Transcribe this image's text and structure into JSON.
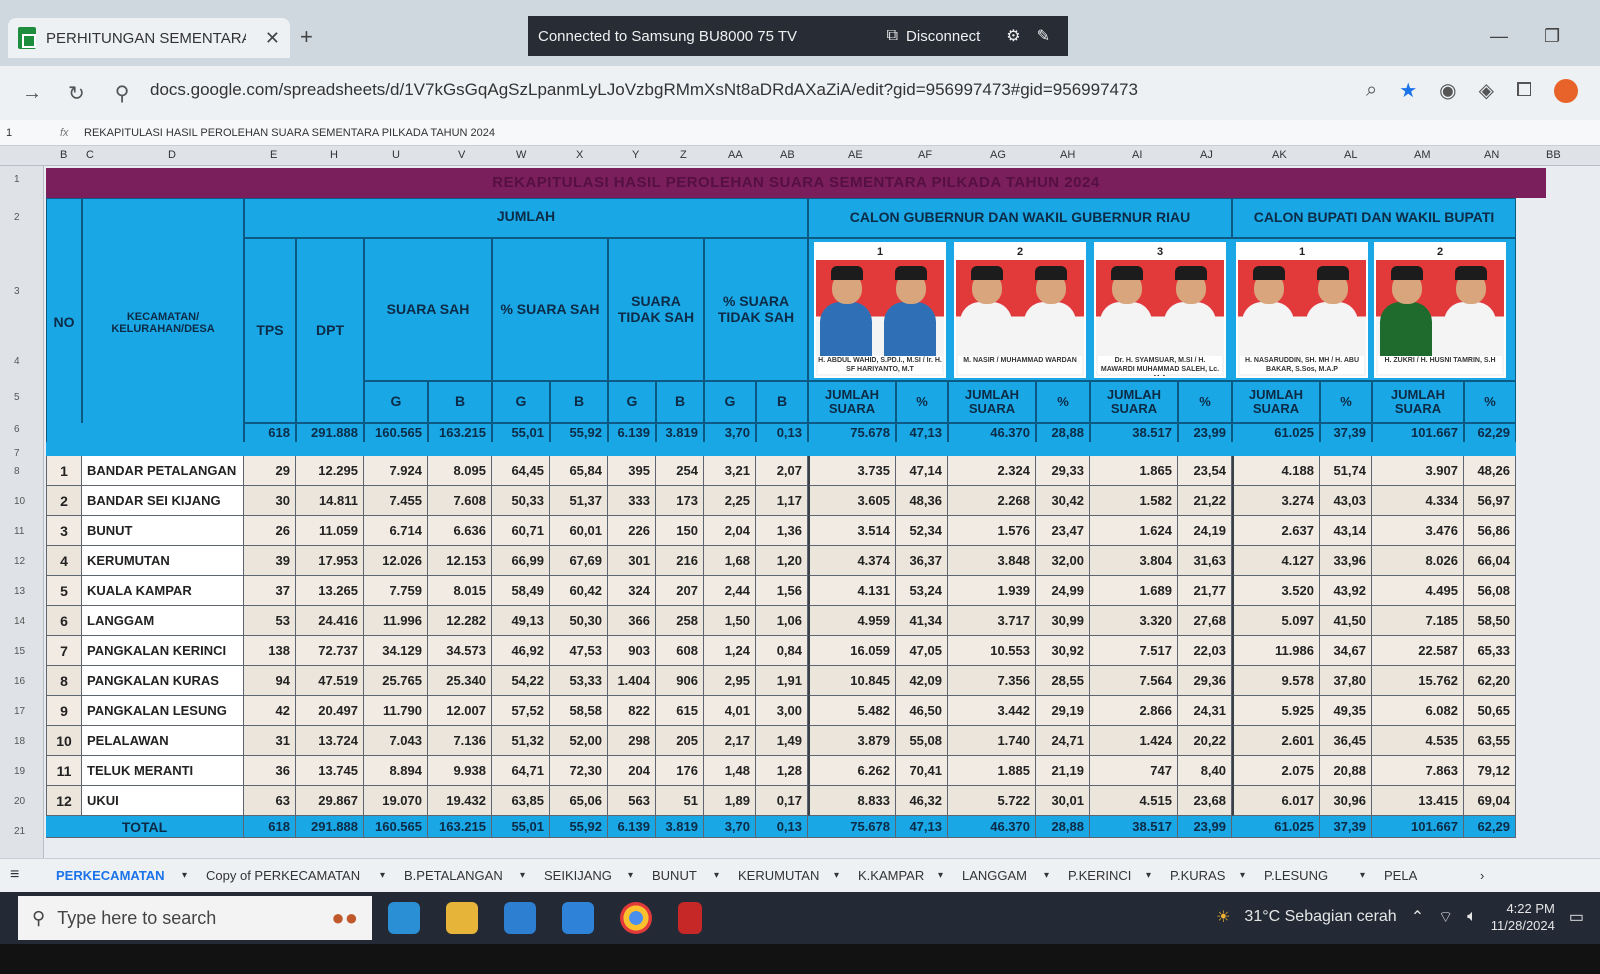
{
  "browser": {
    "tab_title": "PERHITUNGAN SEMENTARA PI",
    "close_glyph": "✕",
    "new_tab_glyph": "+",
    "cast_status": "Connected to Samsung BU8000 75 TV",
    "disconnect_label": "Disconnect",
    "url": "docs.google.com/spreadsheets/d/1V7kGsGqAgSzLpanmLyLJoVzbgRMmXsNt8aDRdAXaZiA/edit?gid=956997473#gid=956997473"
  },
  "formula_bar": {
    "cell_ref": "1",
    "fx": "fx",
    "content": "REKAPITULASI HASIL PEROLEHAN SUARA SEMENTARA PILKADA TAHUN 2024"
  },
  "column_letters": [
    "B",
    "C",
    "D",
    "E",
    "H",
    "U",
    "V",
    "W",
    "X",
    "Y",
    "Z",
    "AA",
    "AB",
    "AE",
    "AF",
    "AG",
    "AH",
    "AI",
    "AJ",
    "AK",
    "AL",
    "AM",
    "AN",
    "BB"
  ],
  "row_numbers": [
    "1",
    "2",
    "3",
    "4",
    "5",
    "6",
    "7",
    "8",
    "10",
    "11",
    "12",
    "13",
    "14",
    "15",
    "16",
    "17",
    "18",
    "19",
    "20",
    "21"
  ],
  "table": {
    "title": "REKAPITULASI HASIL PEROLEHAN SUARA SEMENTARA PILKADA TAHUN 2024",
    "headers": {
      "no": "NO",
      "kecamatan": "KECAMATAN/ KELURAHAN/DESA",
      "jumlah": "JUMLAH",
      "tps": "TPS",
      "dpt": "DPT",
      "suara_sah": "SUARA SAH",
      "pct_suara_sah": "% SUARA SAH",
      "suara_tidak_sah": "SUARA TIDAK SAH",
      "pct_suara_tidak_sah": "% SUARA TIDAK SAH",
      "gubernur": "CALON GUBERNUR DAN WAKIL GUBERNUR RIAU",
      "bupati": "CALON BUPATI DAN WAKIL BUPATI",
      "g": "G",
      "b": "B",
      "jumlah_suara": "JUMLAH SUARA",
      "pct": "%"
    },
    "candidates": [
      {
        "num": "1",
        "plate": "H. ABDUL WAHID, S.PD.I., M.SI / Ir. H. SF HARIYANTO, M.T"
      },
      {
        "num": "2",
        "plate": "M. NASIR / MUHAMMAD WARDAN"
      },
      {
        "num": "3",
        "plate": "Dr. H. SYAMSUAR, M.SI / H. MAWARDI MUHAMMAD SALEH, Lc. M.A"
      },
      {
        "num": "1",
        "plate": "H. NASARUDDIN, SH. MH / H. ABU BAKAR, S.Sos, M.A.P"
      },
      {
        "num": "2",
        "plate": "H. ZUKRI / H. HUSNI TAMRIN, S.H"
      }
    ],
    "summary": [
      "618",
      "291.888",
      "160.565",
      "163.215",
      "55,01",
      "55,92",
      "6.139",
      "3.819",
      "3,70",
      "0,13",
      "75.678",
      "47,13",
      "46.370",
      "28,88",
      "38.517",
      "23,99",
      "61.025",
      "37,39",
      "101.667",
      "62,29"
    ],
    "rows": [
      {
        "no": "1",
        "name": "BANDAR PETALANGAN",
        "v": [
          "29",
          "12.295",
          "7.924",
          "8.095",
          "64,45",
          "65,84",
          "395",
          "254",
          "3,21",
          "2,07",
          "3.735",
          "47,14",
          "2.324",
          "29,33",
          "1.865",
          "23,54",
          "4.188",
          "51,74",
          "3.907",
          "48,26"
        ]
      },
      {
        "no": "2",
        "name": "BANDAR SEI KIJANG",
        "v": [
          "30",
          "14.811",
          "7.455",
          "7.608",
          "50,33",
          "51,37",
          "333",
          "173",
          "2,25",
          "1,17",
          "3.605",
          "48,36",
          "2.268",
          "30,42",
          "1.582",
          "21,22",
          "3.274",
          "43,03",
          "4.334",
          "56,97"
        ]
      },
      {
        "no": "3",
        "name": "BUNUT",
        "v": [
          "26",
          "11.059",
          "6.714",
          "6.636",
          "60,71",
          "60,01",
          "226",
          "150",
          "2,04",
          "1,36",
          "3.514",
          "52,34",
          "1.576",
          "23,47",
          "1.624",
          "24,19",
          "2.637",
          "43,14",
          "3.476",
          "56,86"
        ]
      },
      {
        "no": "4",
        "name": "KERUMUTAN",
        "v": [
          "39",
          "17.953",
          "12.026",
          "12.153",
          "66,99",
          "67,69",
          "301",
          "216",
          "1,68",
          "1,20",
          "4.374",
          "36,37",
          "3.848",
          "32,00",
          "3.804",
          "31,63",
          "4.127",
          "33,96",
          "8.026",
          "66,04"
        ]
      },
      {
        "no": "5",
        "name": "KUALA KAMPAR",
        "v": [
          "37",
          "13.265",
          "7.759",
          "8.015",
          "58,49",
          "60,42",
          "324",
          "207",
          "2,44",
          "1,56",
          "4.131",
          "53,24",
          "1.939",
          "24,99",
          "1.689",
          "21,77",
          "3.520",
          "43,92",
          "4.495",
          "56,08"
        ]
      },
      {
        "no": "6",
        "name": "LANGGAM",
        "v": [
          "53",
          "24.416",
          "11.996",
          "12.282",
          "49,13",
          "50,30",
          "366",
          "258",
          "1,50",
          "1,06",
          "4.959",
          "41,34",
          "3.717",
          "30,99",
          "3.320",
          "27,68",
          "5.097",
          "41,50",
          "7.185",
          "58,50"
        ]
      },
      {
        "no": "7",
        "name": "PANGKALAN KERINCI",
        "v": [
          "138",
          "72.737",
          "34.129",
          "34.573",
          "46,92",
          "47,53",
          "903",
          "608",
          "1,24",
          "0,84",
          "16.059",
          "47,05",
          "10.553",
          "30,92",
          "7.517",
          "22,03",
          "11.986",
          "34,67",
          "22.587",
          "65,33"
        ]
      },
      {
        "no": "8",
        "name": "PANGKALAN KURAS",
        "v": [
          "94",
          "47.519",
          "25.765",
          "25.340",
          "54,22",
          "53,33",
          "1.404",
          "906",
          "2,95",
          "1,91",
          "10.845",
          "42,09",
          "7.356",
          "28,55",
          "7.564",
          "29,36",
          "9.578",
          "37,80",
          "15.762",
          "62,20"
        ]
      },
      {
        "no": "9",
        "name": "PANGKALAN LESUNG",
        "v": [
          "42",
          "20.497",
          "11.790",
          "12.007",
          "57,52",
          "58,58",
          "822",
          "615",
          "4,01",
          "3,00",
          "5.482",
          "46,50",
          "3.442",
          "29,19",
          "2.866",
          "24,31",
          "5.925",
          "49,35",
          "6.082",
          "50,65"
        ]
      },
      {
        "no": "10",
        "name": "PELALAWAN",
        "v": [
          "31",
          "13.724",
          "7.043",
          "7.136",
          "51,32",
          "52,00",
          "298",
          "205",
          "2,17",
          "1,49",
          "3.879",
          "55,08",
          "1.740",
          "24,71",
          "1.424",
          "20,22",
          "2.601",
          "36,45",
          "4.535",
          "63,55"
        ]
      },
      {
        "no": "11",
        "name": "TELUK MERANTI",
        "v": [
          "36",
          "13.745",
          "8.894",
          "9.938",
          "64,71",
          "72,30",
          "204",
          "176",
          "1,48",
          "1,28",
          "6.262",
          "70,41",
          "1.885",
          "21,19",
          "747",
          "8,40",
          "2.075",
          "20,88",
          "7.863",
          "79,12"
        ]
      },
      {
        "no": "12",
        "name": "UKUI",
        "v": [
          "63",
          "29.867",
          "19.070",
          "19.432",
          "63,85",
          "65,06",
          "563",
          "51",
          "1,89",
          "0,17",
          "8.833",
          "46,32",
          "5.722",
          "30,01",
          "4.515",
          "23,68",
          "6.017",
          "30,96",
          "13.415",
          "69,04"
        ]
      }
    ],
    "total": {
      "label": "TOTAL",
      "v": [
        "618",
        "291.888",
        "160.565",
        "163.215",
        "55,01",
        "55,92",
        "6.139",
        "3.819",
        "3,70",
        "0,13",
        "75.678",
        "47,13",
        "46.370",
        "28,88",
        "38.517",
        "23,99",
        "61.025",
        "37,39",
        "101.667",
        "62,29"
      ]
    }
  },
  "sheet_tabs": [
    "PERKECAMATAN",
    "Copy of PERKECAMATAN",
    "B.PETALANGAN",
    "SEIKIJANG",
    "BUNUT",
    "KERUMUTAN",
    "K.KAMPAR",
    "LANGGAM",
    "P.KERINCI",
    "P.KURAS",
    "P.LESUNG",
    "PELA"
  ],
  "taskbar": {
    "search_placeholder": "Type here to search",
    "weather": "31°C  Sebagian cerah",
    "time": "4:22 PM",
    "date": "11/28/2024"
  },
  "colors": {
    "header_blue": "#1aa7e6",
    "title_bar": "#7a1f5c",
    "photo_red": "#e23a3a"
  }
}
